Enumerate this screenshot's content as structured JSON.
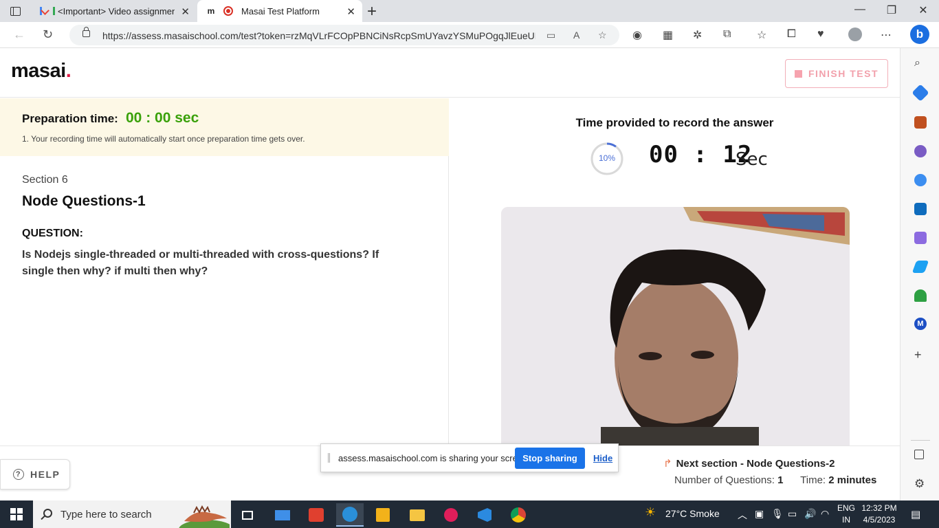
{
  "browser": {
    "tabs": [
      {
        "title": "<Important> Video assignment",
        "icon": "gmail-icon",
        "active": false
      },
      {
        "title": "Masai Test Platform",
        "icon": "masai-icon",
        "active": true
      }
    ],
    "url": "https://assess.masaischool.com/test?token=rzMqVLrFCOpPBNCiNsRcpSmUYavzYSMuPOgqJlEueUEq..."
  },
  "header": {
    "logo": "masai",
    "finish_label": "FINISH TEST"
  },
  "prep": {
    "label": "Preparation time:",
    "value": "00 : 00 sec",
    "note": "1. Your recording time will automatically start once preparation time gets over."
  },
  "question": {
    "section": "Section 6",
    "title": "Node Questions-1",
    "label": "QUESTION:",
    "text": "Is Nodejs single-threaded or multi-threaded with cross-questions? If single then why? if multi then why?"
  },
  "recorder": {
    "title": "Time provided to record the answer",
    "progress_label": "10%",
    "progress_fraction": 0.1,
    "time": "00 : 12",
    "time_unit": "Sec"
  },
  "footer": {
    "help_label": "HELP",
    "next_title": "Next section - Node Questions-2",
    "questions_label": "Number of Questions:",
    "questions_value": "1",
    "time_label": "Time:",
    "time_value": "2 minutes"
  },
  "sharing": {
    "message": "assess.masaischool.com is sharing your screen.",
    "stop_label": "Stop sharing",
    "hide_label": "Hide"
  },
  "taskbar": {
    "search_placeholder": "Type here to search",
    "weather": "27°C  Smoke",
    "lang_line1": "ENG",
    "lang_line2": "IN",
    "time": "12:32 PM",
    "date": "4/5/2023"
  },
  "colors": {
    "accent_green": "#3aa10a",
    "finish_pink": "#f2a0ab",
    "share_blue": "#1a73e8",
    "ring_blue": "#4a6fd6"
  }
}
